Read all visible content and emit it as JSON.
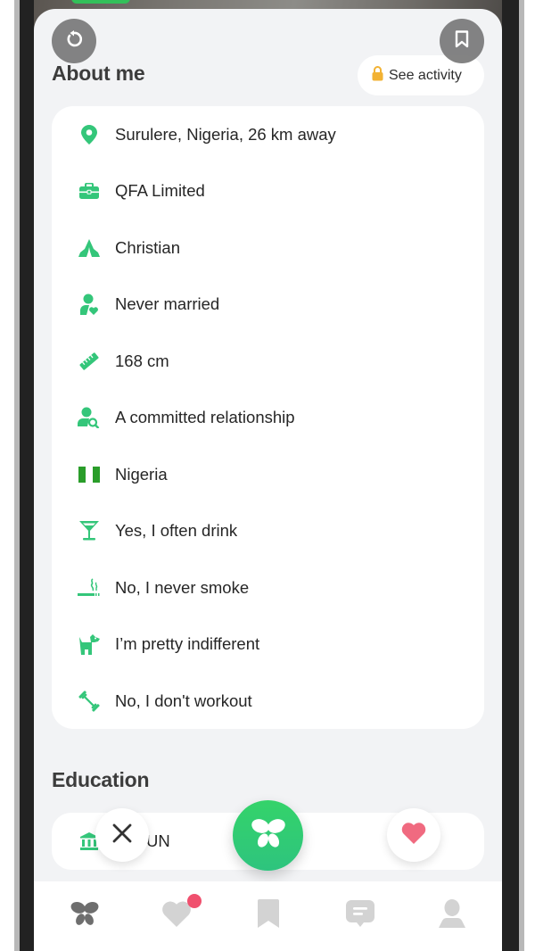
{
  "colors": {
    "accent_green": "#34c67a",
    "nigeria_green": "#2a9d2a",
    "lock_yellow": "#f2b233",
    "like_pink": "#f06a80",
    "badge_red": "#f0506e",
    "nav_active": "#6e6e6e",
    "nav_inactive": "#d3d3d3"
  },
  "top_buttons": {
    "undo_icon": "undo-icon",
    "bookmark_icon": "bookmark-icon"
  },
  "about": {
    "title": "About me",
    "see_activity": {
      "icon": "lock-icon",
      "label": "See activity"
    },
    "items": [
      {
        "icon": "location-pin-icon",
        "label": "Surulere, Nigeria, 26 km away"
      },
      {
        "icon": "briefcase-icon",
        "label": "QFA Limited"
      },
      {
        "icon": "praying-hands-icon",
        "label": "Christian"
      },
      {
        "icon": "person-heart-icon",
        "label": "Never married"
      },
      {
        "icon": "ruler-icon",
        "label": "168 cm"
      },
      {
        "icon": "person-search-icon",
        "label": "A committed relationship"
      },
      {
        "icon": "nigeria-flag-icon",
        "label": "Nigeria"
      },
      {
        "icon": "cocktail-icon",
        "label": "Yes, I often drink"
      },
      {
        "icon": "smoking-icon",
        "label": "No, I never smoke"
      },
      {
        "icon": "dog-icon",
        "label": "I’m pretty indifferent"
      },
      {
        "icon": "dumbbell-icon",
        "label": "No, I don't workout"
      }
    ]
  },
  "education": {
    "title": "Education",
    "items": [
      {
        "icon": "institution-icon",
        "label": "UN"
      }
    ]
  },
  "actions": {
    "pass": "close-icon",
    "boost": "butterfly-icon",
    "like": "heart-icon"
  },
  "bottom_nav": {
    "items": [
      {
        "name": "discover",
        "icon": "butterfly-icon",
        "active": true,
        "badge": false
      },
      {
        "name": "likes",
        "icon": "heart-icon",
        "active": false,
        "badge": true
      },
      {
        "name": "saved",
        "icon": "bookmark-icon",
        "active": false,
        "badge": false
      },
      {
        "name": "messages",
        "icon": "chat-icon",
        "active": false,
        "badge": false
      },
      {
        "name": "profile",
        "icon": "person-icon",
        "active": false,
        "badge": false
      }
    ]
  }
}
